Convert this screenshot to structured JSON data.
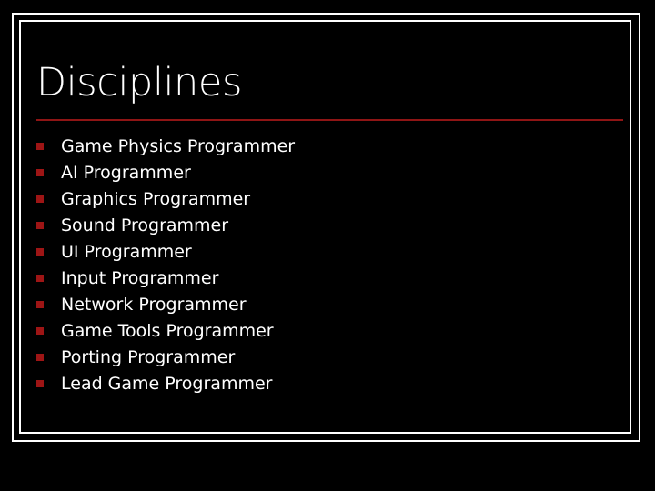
{
  "slide": {
    "title": "Disciplines",
    "background_color": "#000000",
    "frame_color": "#ffffff",
    "rule_color": "#8f1515",
    "bullet_color": "#9e1515",
    "text_color": "#ffffff",
    "bullet_icon": "square-bullet-icon",
    "items": [
      {
        "label": "Game Physics Programmer"
      },
      {
        "label": "AI Programmer"
      },
      {
        "label": "Graphics Programmer"
      },
      {
        "label": "Sound Programmer"
      },
      {
        "label": "UI Programmer"
      },
      {
        "label": "Input Programmer"
      },
      {
        "label": "Network Programmer"
      },
      {
        "label": "Game Tools Programmer"
      },
      {
        "label": "Porting Programmer"
      },
      {
        "label": "Lead Game Programmer"
      }
    ]
  }
}
